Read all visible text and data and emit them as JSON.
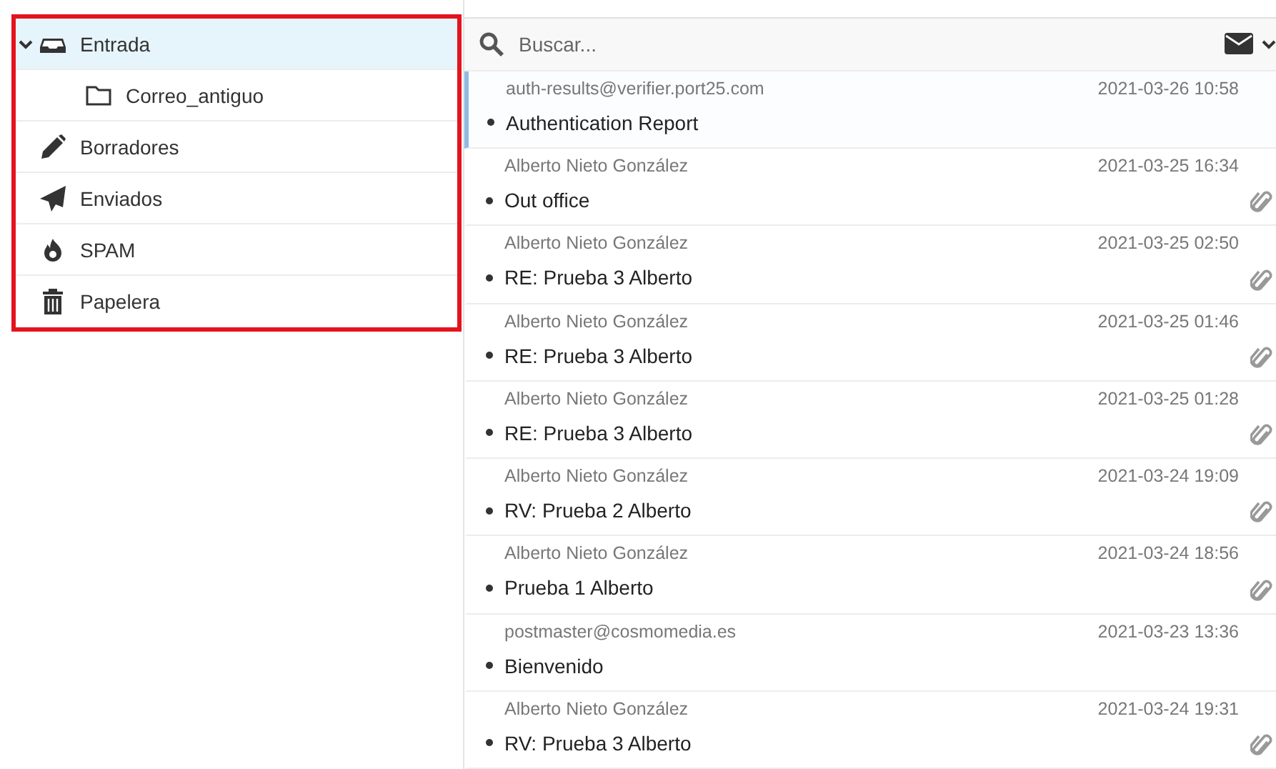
{
  "folders": [
    {
      "label": "Entrada",
      "kind": "inbox",
      "selected": true,
      "expanded": true,
      "children": [
        {
          "label": "Correo_antiguo",
          "kind": "folder",
          "selected": false
        }
      ]
    },
    {
      "label": "Borradores",
      "kind": "drafts",
      "selected": false
    },
    {
      "label": "Enviados",
      "kind": "sent",
      "selected": false
    },
    {
      "label": "SPAM",
      "kind": "spam",
      "selected": false
    },
    {
      "label": "Papelera",
      "kind": "trash",
      "selected": false
    }
  ],
  "search": {
    "placeholder": "Buscar..."
  },
  "messages": [
    {
      "sender": "auth-results@verifier.port25.com",
      "date": "2021-03-26 10:58",
      "subject": "Authentication Report",
      "attachment": false,
      "selected": true
    },
    {
      "sender": "Alberto Nieto González",
      "date": "2021-03-25 16:34",
      "subject": "Out office",
      "attachment": true,
      "selected": false
    },
    {
      "sender": "Alberto Nieto González",
      "date": "2021-03-25 02:50",
      "subject": "RE: Prueba 3 Alberto",
      "attachment": true,
      "selected": false
    },
    {
      "sender": "Alberto Nieto González",
      "date": "2021-03-25 01:46",
      "subject": "RE: Prueba 3 Alberto",
      "attachment": true,
      "selected": false
    },
    {
      "sender": "Alberto Nieto González",
      "date": "2021-03-25 01:28",
      "subject": "RE: Prueba 3 Alberto",
      "attachment": true,
      "selected": false
    },
    {
      "sender": "Alberto Nieto González",
      "date": "2021-03-24 19:09",
      "subject": "RV: Prueba 2 Alberto",
      "attachment": true,
      "selected": false
    },
    {
      "sender": "Alberto Nieto González",
      "date": "2021-03-24 18:56",
      "subject": "Prueba 1 Alberto",
      "attachment": true,
      "selected": false
    },
    {
      "sender": "postmaster@cosmomedia.es",
      "date": "2021-03-23 13:36",
      "subject": "Bienvenido",
      "attachment": false,
      "selected": false
    },
    {
      "sender": "Alberto Nieto González",
      "date": "2021-03-24 19:31",
      "subject": "RV: Prueba 3 Alberto",
      "attachment": true,
      "selected": false
    }
  ]
}
